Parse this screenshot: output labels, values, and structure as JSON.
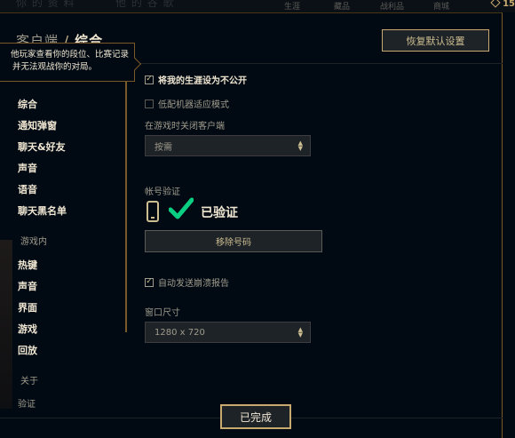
{
  "backdrop": {
    "faded_left": "你 的 资 料",
    "faded_mid": "他 的 谷 歌",
    "nav": [
      "生涯",
      "藏品",
      "战利品",
      "商城"
    ],
    "currency": "15"
  },
  "header": {
    "section": "客户端",
    "separator": "/",
    "current": "综合",
    "reset_label": "恢复默认设置"
  },
  "tooltip": {
    "line1": "他玩家查看你的段位、比赛记录",
    "line2": "并无法观战你的对局。"
  },
  "sidebar": {
    "client_items": [
      "综合",
      "通知弹窗",
      "聊天&好友",
      "声音",
      "语音",
      "聊天黑名单"
    ],
    "ingame_section": "游戏内",
    "ingame_items": [
      "热键",
      "声音",
      "界面",
      "游戏",
      "回放"
    ],
    "about_section": "关于",
    "about_items": [
      "验证"
    ]
  },
  "general": {
    "private_career": {
      "label": "将我的生涯设为不公开",
      "checked": true
    },
    "low_spec": {
      "label": "低配机器适应模式",
      "checked": false
    },
    "close_client_label": "在游戏时关闭客户端",
    "close_client_value": "按需",
    "account_verify_label": "帐号验证",
    "verified_text": "已验证",
    "remove_number_label": "移除号码",
    "crash_report": {
      "label": "自动发送崩溃报告",
      "checked": true
    },
    "window_size_label": "窗口尺寸",
    "window_size_value": "1280 x 720"
  },
  "footer": {
    "done_label": "已完成"
  },
  "colors": {
    "gold": "#c8aa6e",
    "gold_light": "#f0e6d2",
    "check_green": "#0acf83",
    "background": "#010a13"
  }
}
